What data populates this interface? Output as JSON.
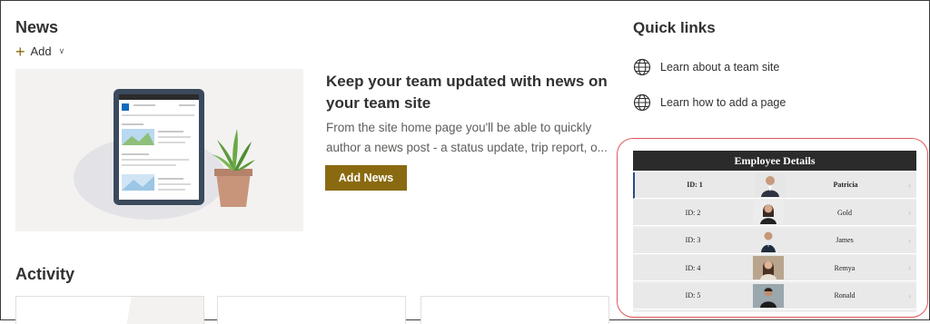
{
  "news": {
    "title": "News",
    "add_label": "Add",
    "headline": "Keep your team updated with news on your team site",
    "description": "From the site home page you'll be able to quickly author a news post - a status update, trip report, o...",
    "add_news_label": "Add News"
  },
  "activity": {
    "title": "Activity"
  },
  "quick_links": {
    "title": "Quick links",
    "items": [
      {
        "label": "Learn about a team site",
        "icon": "globe-icon"
      },
      {
        "label": "Learn how to add a page",
        "icon": "globe-icon"
      }
    ]
  },
  "employees": {
    "title": "Employee Details",
    "rows": [
      {
        "id": "ID: 1",
        "name": "Patricia"
      },
      {
        "id": "ID: 2",
        "name": "Gold"
      },
      {
        "id": "ID: 3",
        "name": "James"
      },
      {
        "id": "ID: 4",
        "name": "Remya"
      },
      {
        "id": "ID: 5",
        "name": "Ronald"
      }
    ]
  },
  "colors": {
    "accent": "#8a6a10",
    "highlight": "#e0575b",
    "header_dark": "#2b2b2b"
  }
}
